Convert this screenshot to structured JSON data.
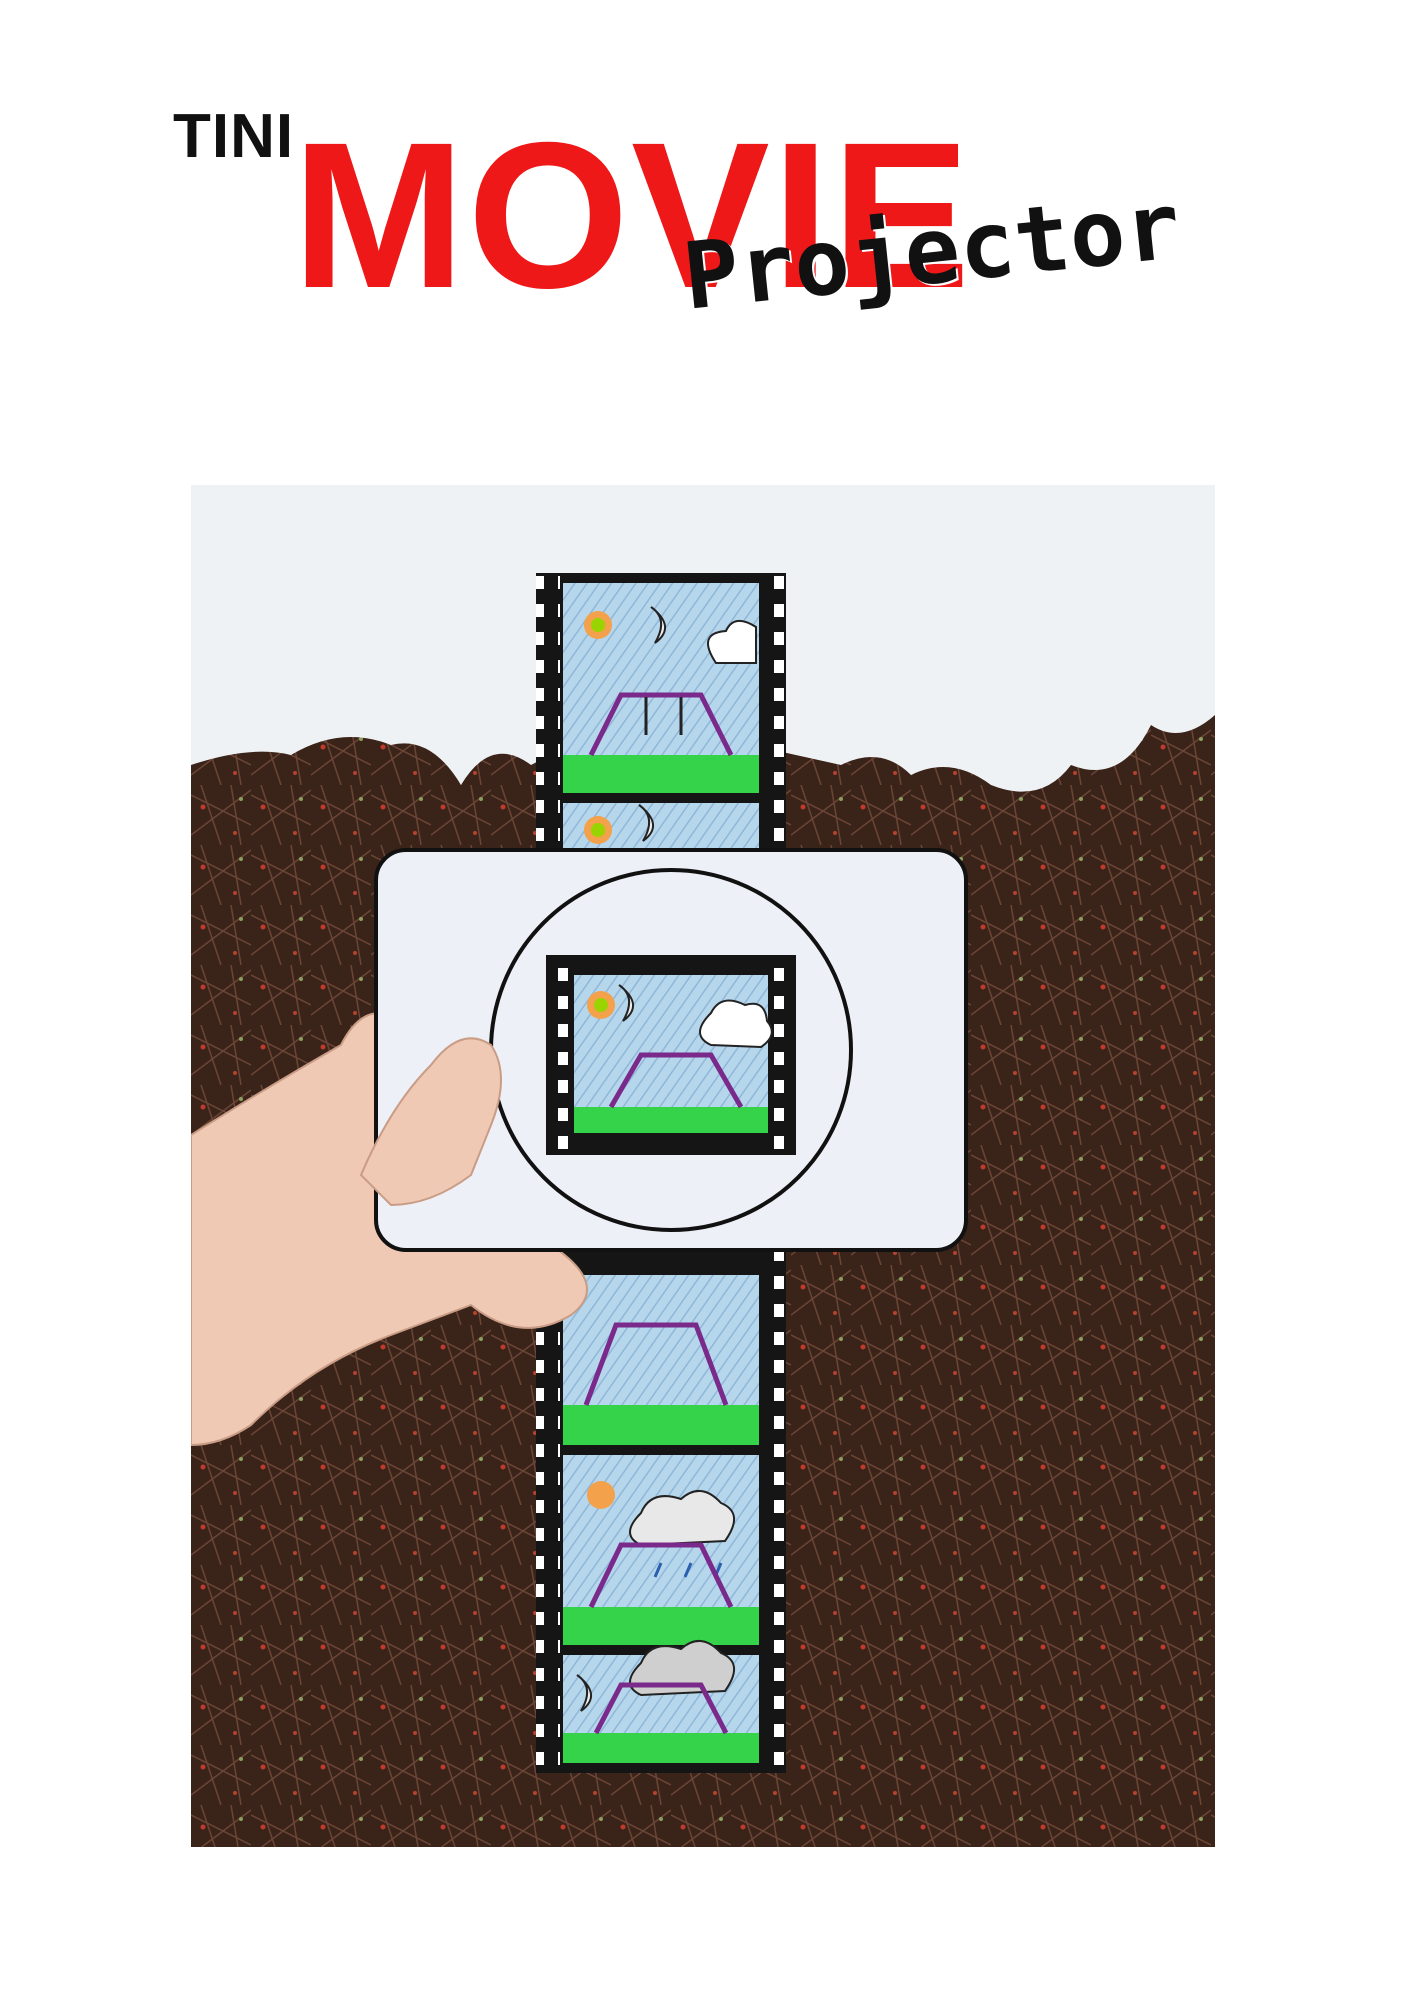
{
  "title": {
    "small": "TINI",
    "main": "MOVIE",
    "script": "Projector"
  },
  "colors": {
    "title_red": "#ef1818",
    "title_black": "#111111",
    "sky": "#a9cde6",
    "grass": "#34d34a",
    "swing": "#7a2a8a",
    "sun": "#f3a14b"
  },
  "photo": {
    "icons": [
      "film-strip-icon",
      "swing-set-icon",
      "sun-icon",
      "moon-icon",
      "cloud-icon",
      "rain-icon",
      "hand-icon",
      "projector-lens-icon"
    ]
  }
}
